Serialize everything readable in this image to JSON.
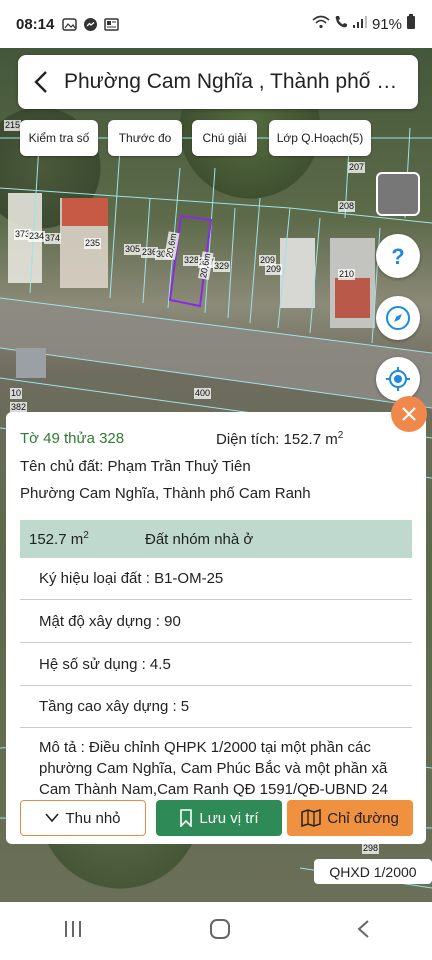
{
  "status": {
    "time": "08:14",
    "battery": "91%"
  },
  "header": {
    "title": "Phường Cam Nghĩa , Thành phố Cam Ranh"
  },
  "toolbar": {
    "check_label": "Kiểm tra số",
    "ruler_label": "Thước đo",
    "legend_label": "Chú giải",
    "layer_label": "Lớp Q.Hoạch(5)"
  },
  "map": {
    "labels": [
      "215",
      "207",
      "208",
      "373",
      "234",
      "374",
      "235",
      "305",
      "236",
      "306",
      "328",
      "237",
      "329",
      "209",
      "209",
      "210",
      "20,6m",
      "20,6m",
      "400",
      "10",
      "382",
      "298"
    ]
  },
  "info": {
    "parcel": "Tờ 49 thửa 328",
    "area_label": "Diện tích: 152.7 m",
    "area_sup": "2",
    "owner": "Tên chủ đất: Phạm Trần Thuỷ Tiên",
    "location": "Phường Cam Nghĩa, Thành phố Cam Ranh",
    "band_area": "152.7 m",
    "band_sup": "2",
    "band_type": "Đất nhóm nhà ở",
    "properties": [
      "Ký hiệu loại đất : B1-OM-25",
      "Mật độ xây dựng : 90",
      "Hệ số sử dụng : 4.5",
      "Tầng cao xây dựng : 5"
    ],
    "description": "Mô tả : Điều chỉnh QHPK 1/2000 tại một phần các phường Cam Nghĩa, Cam Phúc Bắc và một phần xã Cam Thành Nam,Cam Ranh QĐ 1591/QĐ-UBND 24"
  },
  "actions": {
    "shrink_label": "Thu nhỏ",
    "save_label": "Lưu vị trí",
    "route_label": "Chỉ đường"
  },
  "scale_badge": "QHXD 1/2000",
  "colors": {
    "accent_green": "#2e8b57",
    "accent_orange": "#f0913f",
    "band": "#bfd9cf",
    "parcel_highlight": "#8a2be2"
  }
}
